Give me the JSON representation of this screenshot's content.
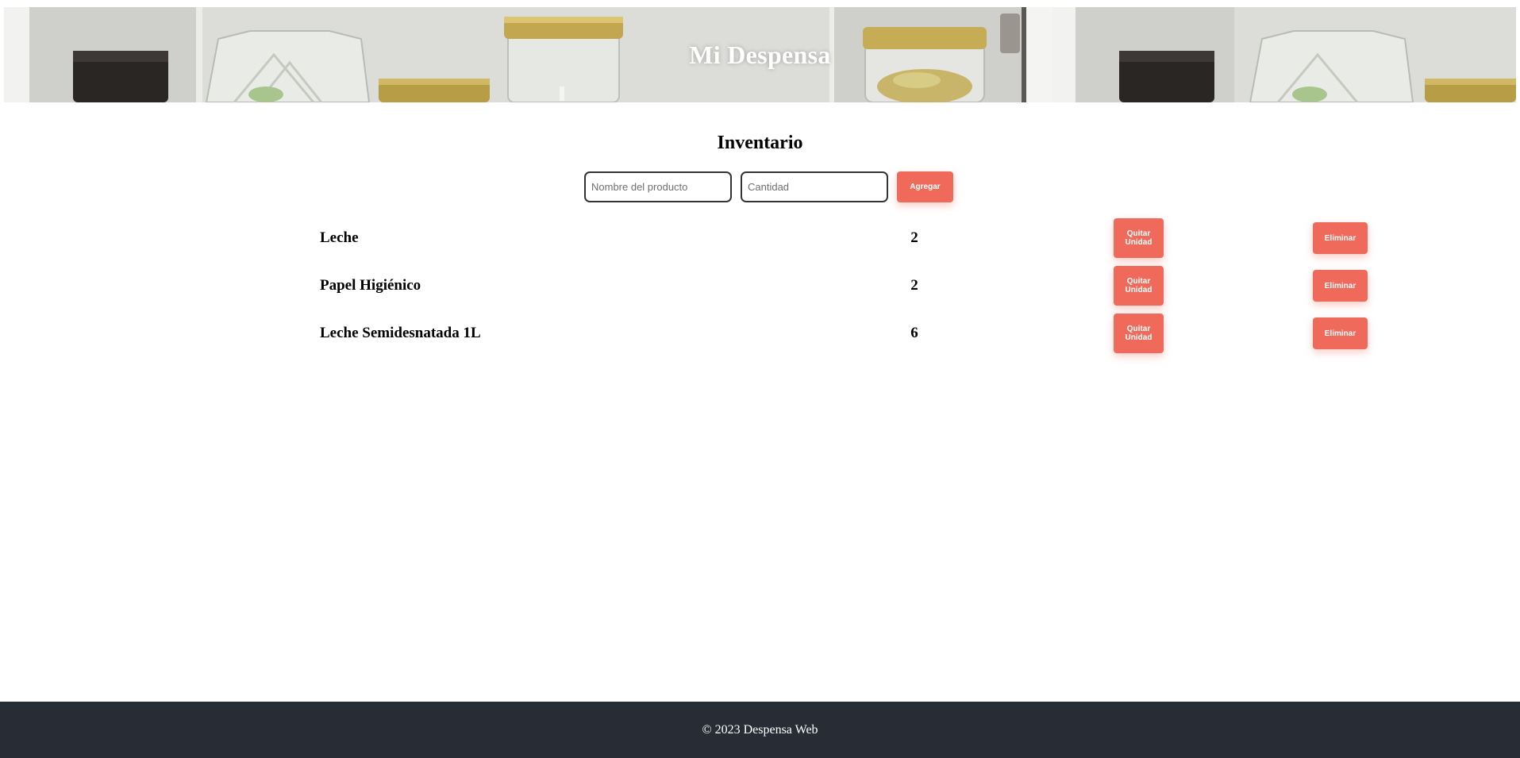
{
  "header": {
    "title": "Mi Despensa"
  },
  "inventory": {
    "title": "Inventario",
    "form": {
      "name_placeholder": "Nombre del producto",
      "qty_placeholder": "Cantidad",
      "add_label": "Agregar"
    },
    "items": [
      {
        "name": "Leche",
        "qty": "2",
        "remove_label": "Quitar Unidad",
        "delete_label": "Eliminar"
      },
      {
        "name": "Papel Higiénico",
        "qty": "2",
        "remove_label": "Quitar Unidad",
        "delete_label": "Eliminar"
      },
      {
        "name": "Leche Semidesnatada 1L",
        "qty": "6",
        "remove_label": "Quitar Unidad",
        "delete_label": "Eliminar"
      }
    ]
  },
  "footer": {
    "text": "© 2023 Despensa Web"
  },
  "colors": {
    "accent": "#ef6a5a",
    "footer_bg": "#282c34"
  }
}
